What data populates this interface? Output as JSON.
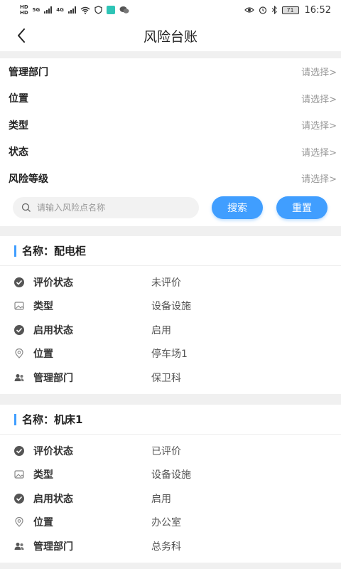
{
  "status_bar": {
    "left_tags": [
      "HD",
      "5G",
      "4G"
    ],
    "battery": "71",
    "time": "16:52",
    "icons": [
      "eye-icon",
      "alarm-icon",
      "bluetooth-icon"
    ]
  },
  "header": {
    "title": "风险台账"
  },
  "filters": [
    {
      "label": "管理部门",
      "value": "请选择>"
    },
    {
      "label": "位置",
      "value": "请选择>"
    },
    {
      "label": "类型",
      "value": "请选择>"
    },
    {
      "label": "状态",
      "value": "请选择>"
    },
    {
      "label": "风险等级",
      "value": "请选择>"
    }
  ],
  "search": {
    "placeholder": "请输入风险点名称",
    "search_label": "搜索",
    "reset_label": "重置"
  },
  "colors": {
    "accent": "#409eff",
    "page_bg": "#f0f0f0"
  },
  "cards": [
    {
      "title": "名称：配电柜",
      "fields": [
        {
          "icon": "check-circle-icon",
          "label": "评价状态",
          "value": "未评价"
        },
        {
          "icon": "image-icon",
          "label": "类型",
          "value": "设备设施"
        },
        {
          "icon": "check-circle-icon",
          "label": "启用状态",
          "value": "启用"
        },
        {
          "icon": "location-pin-icon",
          "label": "位置",
          "value": "停车场1"
        },
        {
          "icon": "users-icon",
          "label": "管理部门",
          "value": "保卫科"
        }
      ]
    },
    {
      "title": "名称：机床1",
      "fields": [
        {
          "icon": "check-circle-icon",
          "label": "评价状态",
          "value": "已评价"
        },
        {
          "icon": "image-icon",
          "label": "类型",
          "value": "设备设施"
        },
        {
          "icon": "check-circle-icon",
          "label": "启用状态",
          "value": "启用"
        },
        {
          "icon": "location-pin-icon",
          "label": "位置",
          "value": "办公室"
        },
        {
          "icon": "users-icon",
          "label": "管理部门",
          "value": "总务科"
        }
      ]
    }
  ]
}
